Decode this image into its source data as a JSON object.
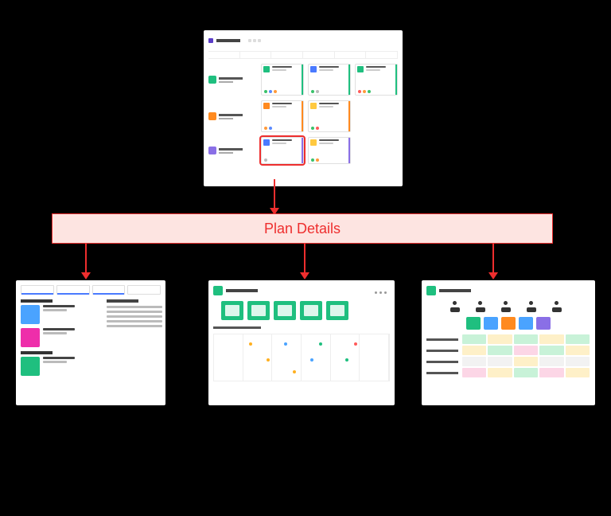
{
  "banner": {
    "label": "Plan Details"
  },
  "colors": {
    "accent": "#ee2e2e",
    "banner_bg": "#fde4e1",
    "green": "#1fbf7f",
    "orange": "#ff8a1f",
    "purple": "#8a6fe6",
    "blue": "#4aa3ff",
    "pink": "#ee2eaa"
  },
  "top_screenshot": {
    "rows": [
      {
        "color": "green",
        "cards": 3
      },
      {
        "color": "orange",
        "cards": 2
      },
      {
        "color": "purple",
        "cards": 2,
        "highlighted_card_index": 0
      }
    ]
  },
  "bottom_screenshots": {
    "left": {
      "items": [
        {
          "tile_color": "blue"
        },
        {
          "tile_color": "pink"
        },
        {
          "tile_color": "green"
        }
      ]
    },
    "center": {
      "tile_count": 5
    },
    "right": {
      "icon_count": 5,
      "category_colors": [
        "green",
        "blue",
        "orange",
        "blue",
        "purple"
      ],
      "matrix_rows": 4
    }
  }
}
